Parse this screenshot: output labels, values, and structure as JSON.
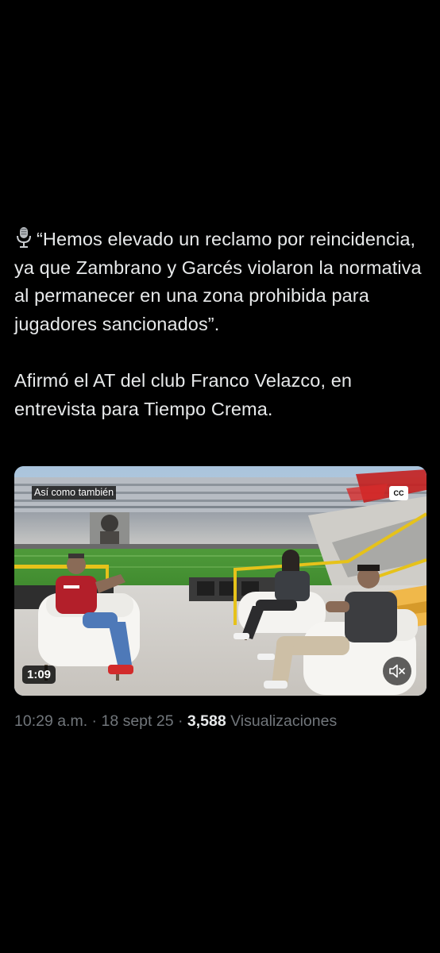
{
  "tweet": {
    "quote_paragraph": "“Hemos elevado un reclamo por reincidencia, ya que Zambrano y Garcés violaron la normativa al permanecer en una zona prohibida para jugadores sancionados”.",
    "attribution_paragraph": "Afirmó el AT del club Franco Velazco, en entrevista para Tiempo Crema."
  },
  "video": {
    "caption_chip": "Así como también",
    "cc_label": "CC",
    "duration": "1:09",
    "mute_icon": "speaker-muted-icon",
    "watermark_icon": "tiempo-crema-logo"
  },
  "meta": {
    "time": "10:29 a.m.",
    "separator_1": " · ",
    "date": "18 sept 25",
    "separator_2": " · ",
    "views_count": "3,588",
    "views_label": " Visualizaciones"
  },
  "colors": {
    "background": "#000000",
    "primary_text": "#e7e9ea",
    "secondary_text": "#71767b"
  }
}
